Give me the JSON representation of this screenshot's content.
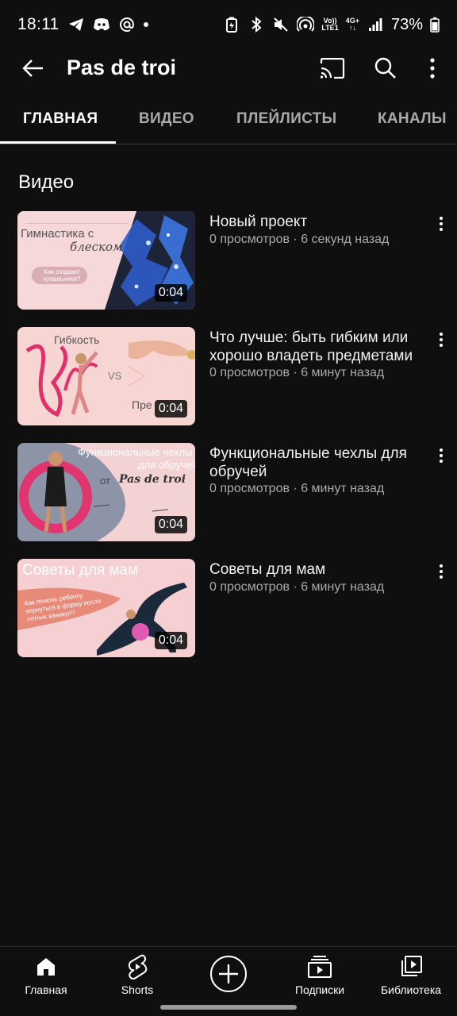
{
  "status_bar": {
    "time": "18:11",
    "left_icons": [
      "telegram-icon",
      "discord-icon",
      "at-icon",
      "notification-dot-icon"
    ],
    "right_icons": [
      "battery-saver-icon",
      "bluetooth-icon",
      "mute-icon",
      "hotspot-icon",
      "volte-icon",
      "4g-icon",
      "signal-icon",
      "battery-icon"
    ],
    "volte_top": "Vo))",
    "volte_bottom": "LTE1",
    "net_top": "4G+",
    "battery": "73%"
  },
  "app_bar": {
    "title": "Pas de troi",
    "icons": [
      "back-arrow-icon",
      "cast-icon",
      "search-icon",
      "more-vert-icon"
    ]
  },
  "tabs": [
    {
      "label": "ГЛАВНАЯ",
      "active": true
    },
    {
      "label": "ВИДЕО",
      "active": false
    },
    {
      "label": "ПЛЕЙЛИСТЫ",
      "active": false
    },
    {
      "label": "КАНАЛЫ",
      "active": false
    }
  ],
  "section": {
    "title": "Видео"
  },
  "videos": [
    {
      "title": "Новый проект",
      "meta": "0 просмотров · 6 секунд назад",
      "duration": "0:04",
      "thumb_text_1": "Гимнастика с",
      "thumb_text_2": "блеском",
      "thumb_text_3": "Как создают купальники?"
    },
    {
      "title": "Что лучше: быть гибким или хорошо владеть предметами",
      "meta": "0 просмотров · 6 минут назад",
      "duration": "0:04",
      "thumb_text_1": "Гибкость",
      "thumb_text_2": "VS",
      "thumb_text_3": "Пре"
    },
    {
      "title": "Функциональные чехлы для обручей",
      "meta": "0 просмотров · 6 минут назад",
      "duration": "0:04",
      "thumb_text_1": "Функциональные чехлы",
      "thumb_text_2": "для обручей",
      "thumb_text_3": "от",
      "thumb_text_4": "Pas de troi"
    },
    {
      "title": "Советы для мам",
      "meta": "0 просмотров · 6 минут назад",
      "duration": "0:04",
      "thumb_text_1": "Советы для мам",
      "thumb_text_2": "Как помочь ребенку вернуться в форму после летних каникул?"
    }
  ],
  "bottom_nav": [
    {
      "label": "Главная",
      "icon": "home-icon"
    },
    {
      "label": "Shorts",
      "icon": "shorts-icon"
    },
    {
      "label": "",
      "icon": "create-plus-icon"
    },
    {
      "label": "Подписки",
      "icon": "subscriptions-icon"
    },
    {
      "label": "Библиотека",
      "icon": "library-icon"
    }
  ],
  "colors": {
    "background": "#0f0f0f",
    "text_primary": "#f1f1f1",
    "text_secondary": "#aaaaaa",
    "thumb_pink": "#f4c9cc",
    "thumb_slate": "#8e94a8",
    "hoop_pink": "#e0356e"
  }
}
